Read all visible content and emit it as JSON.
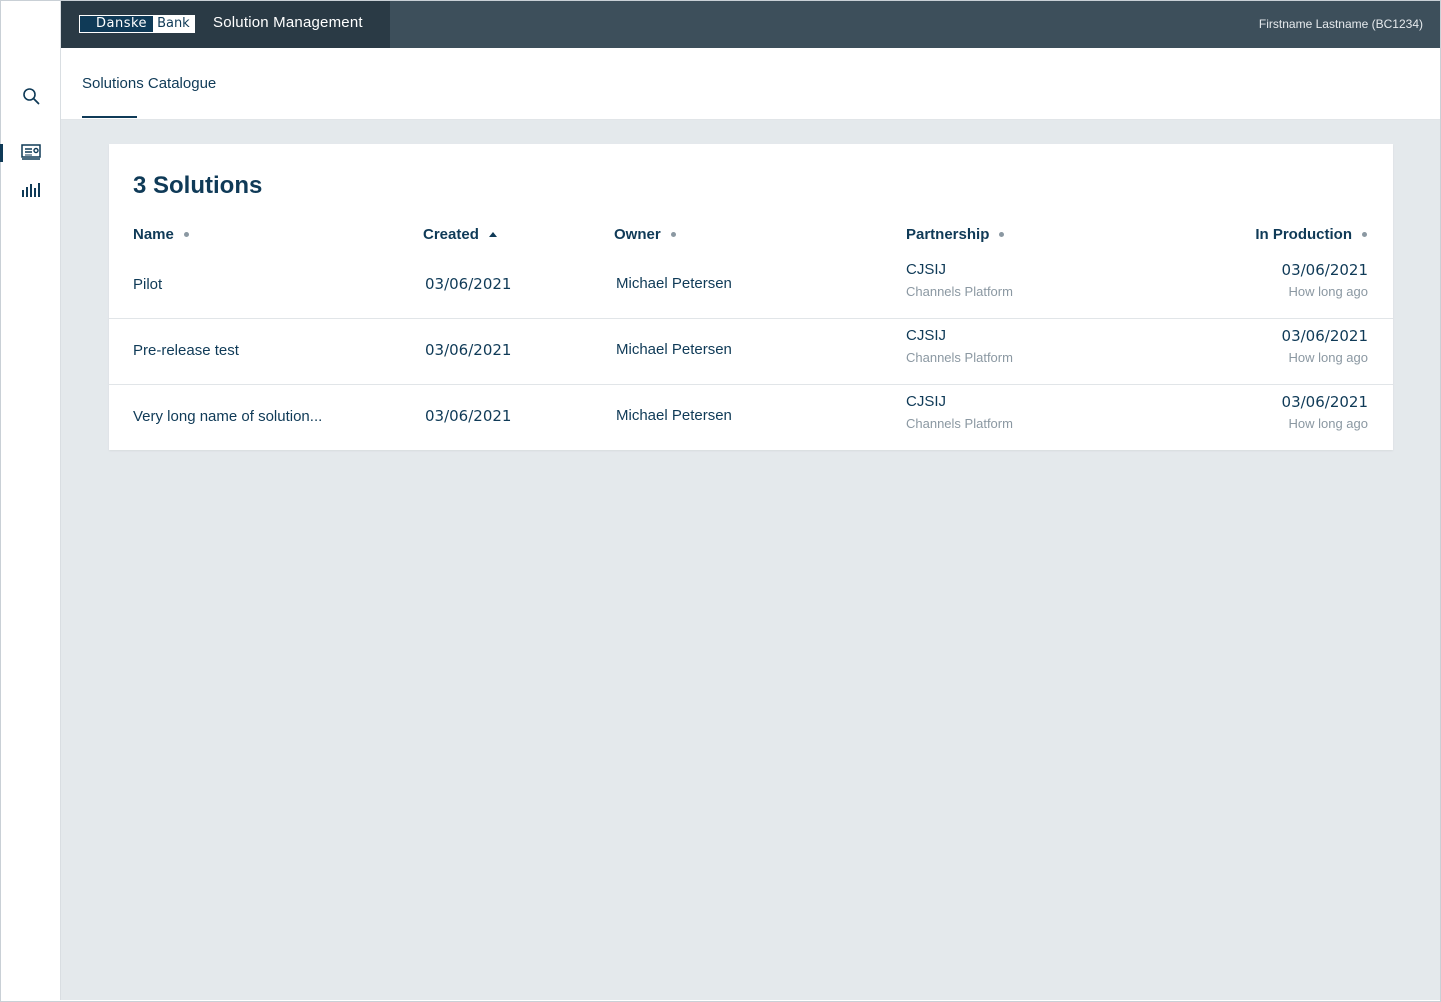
{
  "header": {
    "logo_left": "Danske",
    "logo_right": "Bank",
    "app_title": "Solution Management",
    "user": "Firstname Lastname (BC1234)"
  },
  "sidebar": {
    "items": [
      {
        "icon": "search-icon"
      },
      {
        "icon": "catalogue-icon",
        "active": true
      },
      {
        "icon": "bar-chart-icon"
      }
    ]
  },
  "tabs": [
    {
      "label": "Solutions Catalogue",
      "active": true
    }
  ],
  "main": {
    "title": "3 Solutions",
    "columns": [
      "Name",
      "Created",
      "Owner",
      "Partnership",
      "In Production"
    ],
    "sort": {
      "column": "Created",
      "direction": "ascending"
    },
    "rows": [
      {
        "name": "Pilot",
        "created": "03/06/2021",
        "owner": "Michael Petersen",
        "partnership": "CJSIJ",
        "partnership_sub": "Channels Platform",
        "in_production": "03/06/2021",
        "in_production_sub": "How long ago"
      },
      {
        "name": "Pre-release test",
        "created": "03/06/2021",
        "owner": "Michael Petersen",
        "partnership": "CJSIJ",
        "partnership_sub": "Channels Platform",
        "in_production": "03/06/2021",
        "in_production_sub": "How long ago"
      },
      {
        "name": "Very long name of solution...",
        "created": "03/06/2021",
        "owner": "Michael Petersen",
        "partnership": "CJSIJ",
        "partnership_sub": "Channels Platform",
        "in_production": "03/06/2021",
        "in_production_sub": "How long ago"
      }
    ]
  },
  "colors": {
    "brand_navy": "#0f3a57",
    "header_bg": "#3d4f5b",
    "brand_box_bg": "#2a3a45",
    "content_bg": "#e4e9ec",
    "muted_text": "#8b98a2"
  }
}
